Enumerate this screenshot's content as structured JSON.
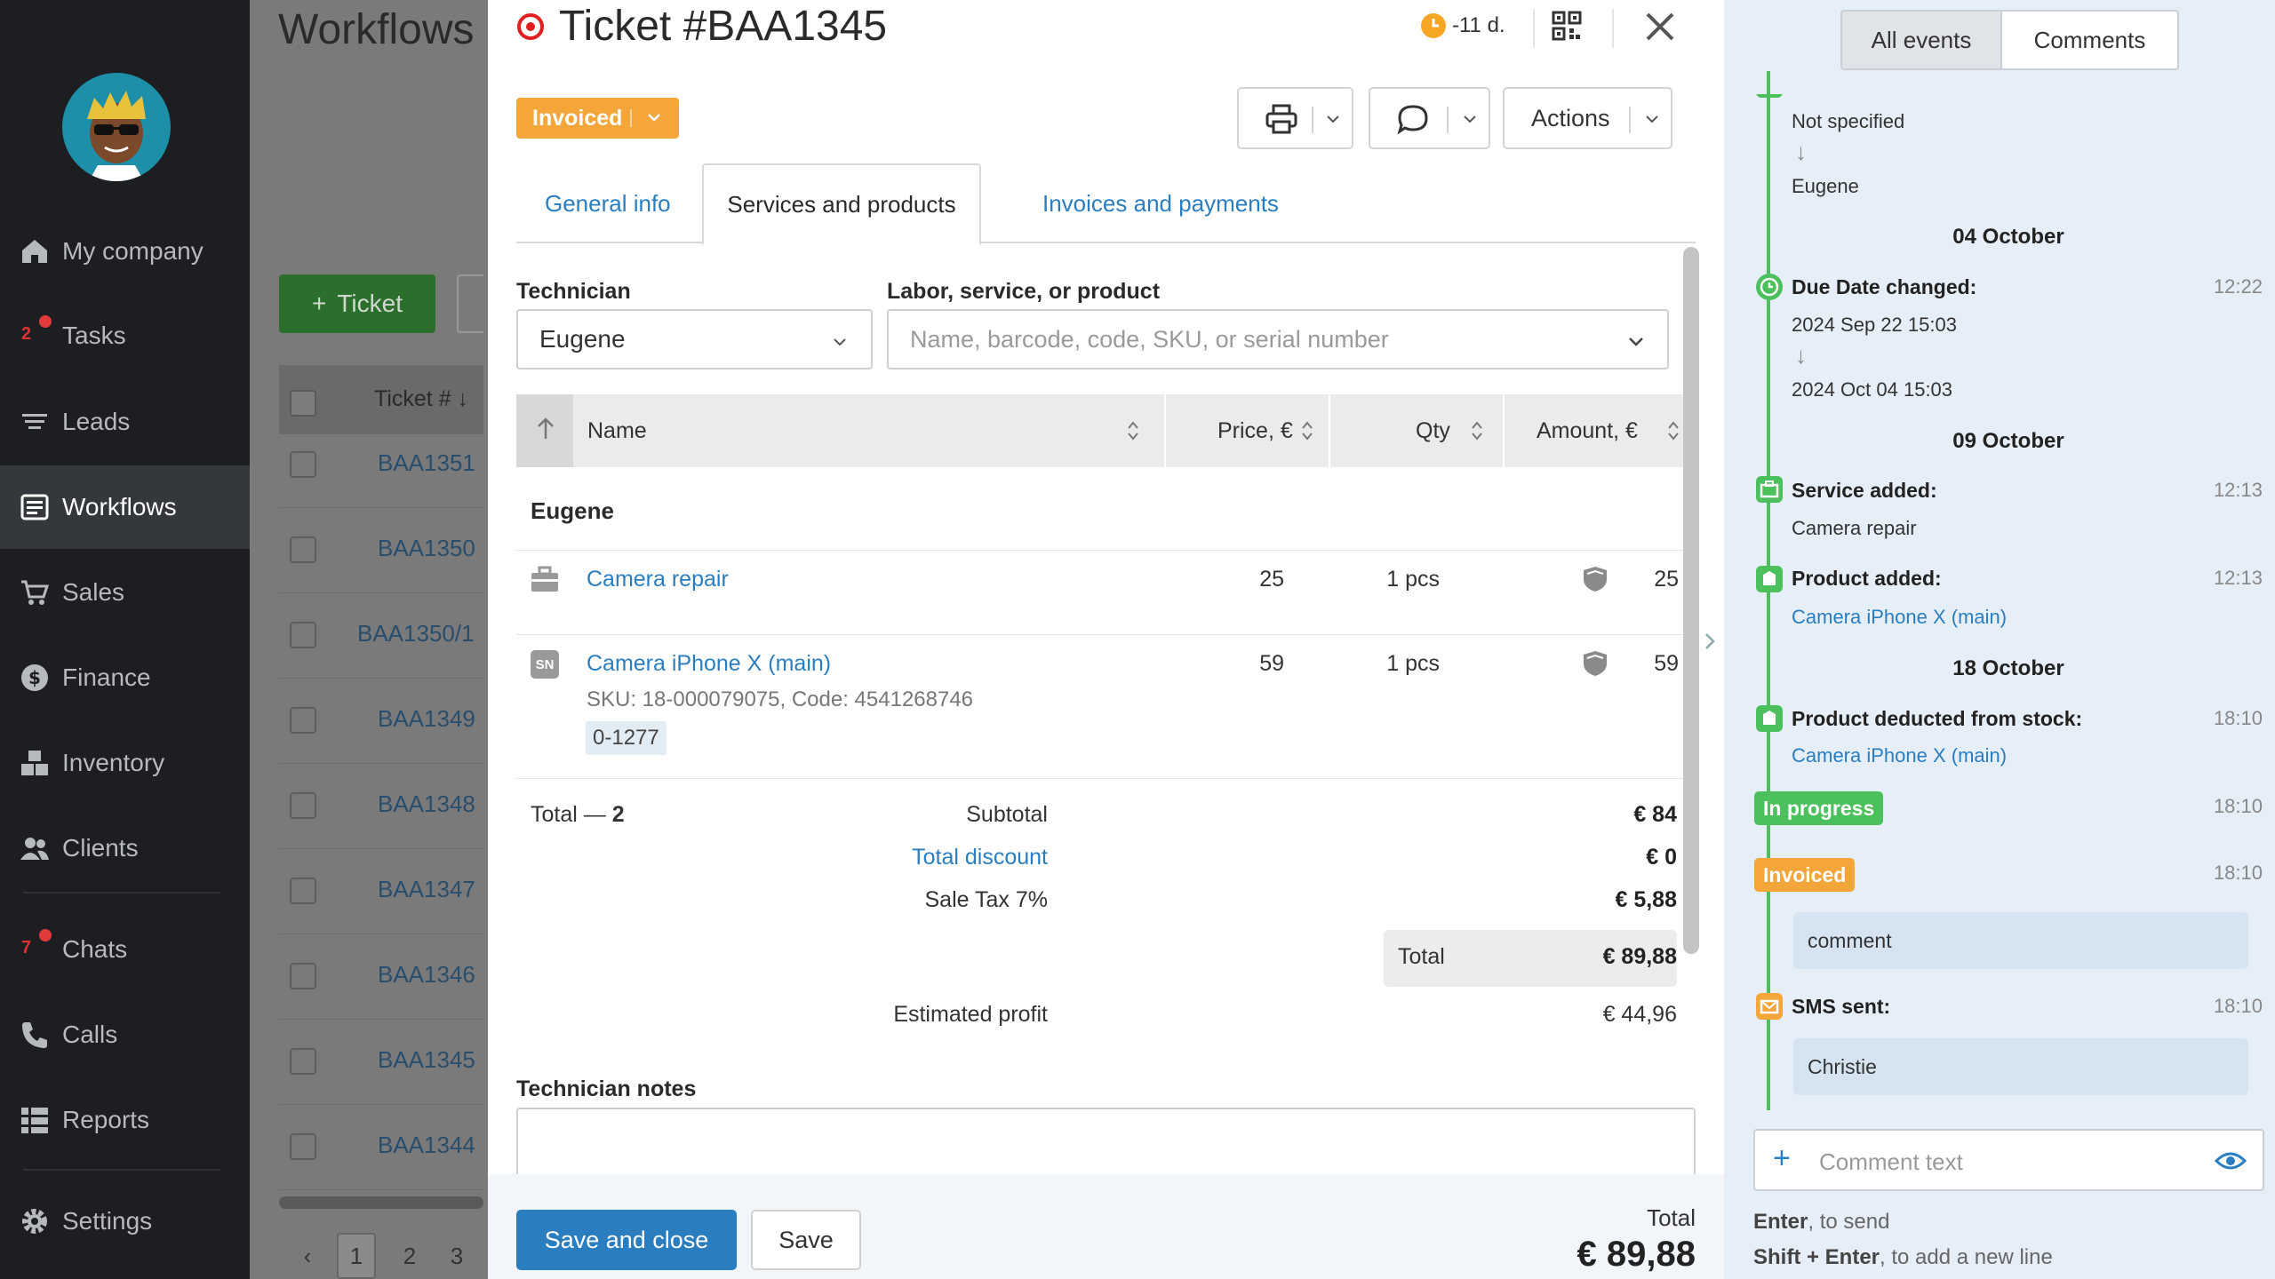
{
  "sidebar": {
    "items": [
      {
        "label": "My company",
        "icon": "home-icon"
      },
      {
        "label": "Tasks",
        "icon": "tasks-icon",
        "badge": "2"
      },
      {
        "label": "Leads",
        "icon": "leads-icon"
      },
      {
        "label": "Workflows",
        "icon": "workflows-icon"
      },
      {
        "label": "Sales",
        "icon": "cart-icon"
      },
      {
        "label": "Finance",
        "icon": "dollar-icon"
      },
      {
        "label": "Inventory",
        "icon": "inventory-icon"
      },
      {
        "label": "Clients",
        "icon": "clients-icon"
      },
      {
        "label": "Chats",
        "icon": "chats-icon",
        "badge": "7"
      },
      {
        "label": "Calls",
        "icon": "phone-icon"
      },
      {
        "label": "Reports",
        "icon": "reports-icon"
      },
      {
        "label": "Settings",
        "icon": "gear-icon"
      }
    ]
  },
  "background": {
    "title": "Workflows",
    "ticket_button": "Ticket",
    "column_ticket": "Ticket #",
    "rows": [
      "BAA1351",
      "BAA1350",
      "BAA1350/1",
      "BAA1349",
      "BAA1348",
      "BAA1347",
      "BAA1346",
      "BAA1345",
      "BAA1344"
    ],
    "pages": [
      "1",
      "2",
      "3"
    ]
  },
  "modal": {
    "title": "Ticket #BAA1345",
    "timer": "-11 d.",
    "status": "Invoiced",
    "actions_label": "Actions",
    "tabs": [
      "General info",
      "Services and products",
      "Invoices and payments"
    ],
    "technician_label": "Technician",
    "technician_value": "Eugene",
    "product_label": "Labor, service, or product",
    "product_placeholder": "Name, barcode, code, SKU, or serial number",
    "columns": {
      "name": "Name",
      "price": "Price, €",
      "qty": "Qty",
      "amount": "Amount, €"
    },
    "group": "Eugene",
    "items": [
      {
        "name": "Camera repair",
        "price": "25",
        "qty": "1 pcs",
        "amount": "25"
      },
      {
        "name": "Camera iPhone X (main)",
        "price": "59",
        "qty": "1 pcs",
        "amount": "59",
        "meta": "SKU: 18-000079075, Code: 4541268746",
        "serial": "0-1277",
        "icon_text": "SN"
      }
    ],
    "total_count_label": "Total —",
    "total_count": "2",
    "totals": {
      "subtotal_label": "Subtotal",
      "subtotal": "€ 84",
      "discount_label": "Total discount",
      "discount": "€ 0",
      "tax_label": "Sale Tax 7%",
      "tax": "€ 5,88",
      "total_label": "Total",
      "total": "€ 89,88",
      "profit_label": "Estimated profit",
      "profit": "€ 44,96"
    },
    "notes_label": "Technician notes",
    "save_close": "Save and close",
    "save": "Save",
    "footer_total_label": "Total",
    "footer_total": "€ 89,88"
  },
  "timeline": {
    "tabs": [
      "All events",
      "Comments"
    ],
    "top_from": "Not specified",
    "top_to": "Eugene",
    "date1": "04 October",
    "due_title": "Due Date changed:",
    "due_time": "12:22",
    "due_from": "2024 Sep 22 15:03",
    "due_to": "2024 Oct 04 15:03",
    "date2": "09 October",
    "service_title": "Service added:",
    "service_time": "12:13",
    "service_value": "Camera repair",
    "product_title": "Product added:",
    "product_time": "12:13",
    "product_value": "Camera iPhone X (main)",
    "date3": "18 October",
    "deduct_title": "Product deducted from stock:",
    "deduct_time": "18:10",
    "deduct_value": "Camera iPhone X (main)",
    "inprogress": "In progress",
    "inprogress_time": "18:10",
    "invoiced": "Invoiced",
    "invoiced_time": "18:10",
    "comment": "comment",
    "sms_title": "SMS sent:",
    "sms_time": "18:10",
    "sms_value": "Christie",
    "comment_placeholder": "Comment text",
    "hint1_key": "Enter",
    "hint1_text": ", to send",
    "hint2_key": "Shift + Enter",
    "hint2_text": ", to add a new line",
    "colors": {
      "green": "#4cc05c",
      "orange": "#f5a63a",
      "blue": "#2a7ec0"
    }
  }
}
